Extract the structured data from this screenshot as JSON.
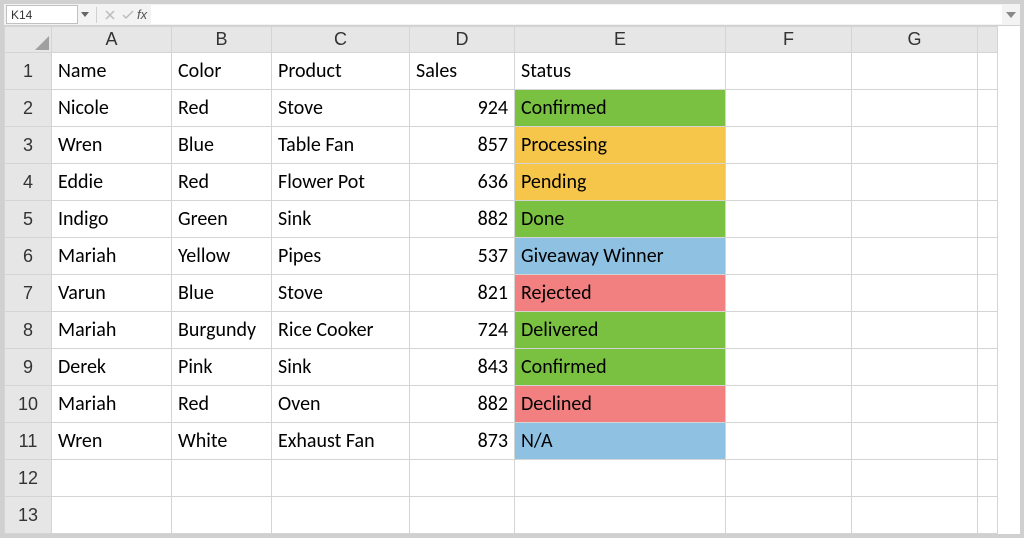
{
  "chart_data": {
    "type": "table",
    "columns": [
      "Name",
      "Color",
      "Product",
      "Sales",
      "Status"
    ],
    "rows": [
      [
        "Nicole",
        "Red",
        "Stove",
        924,
        "Confirmed"
      ],
      [
        "Wren",
        "Blue",
        "Table Fan",
        857,
        "Processing"
      ],
      [
        "Eddie",
        "Red",
        "Flower Pot",
        636,
        "Pending"
      ],
      [
        "Indigo",
        "Green",
        "Sink",
        882,
        "Done"
      ],
      [
        "Mariah",
        "Yellow",
        "Pipes",
        537,
        "Giveaway Winner"
      ],
      [
        "Varun",
        "Blue",
        "Stove",
        821,
        "Rejected"
      ],
      [
        "Mariah",
        "Burgundy",
        "Rice Cooker",
        724,
        "Delivered"
      ],
      [
        "Derek",
        "Pink",
        "Sink",
        843,
        "Confirmed"
      ],
      [
        "Mariah",
        "Red",
        "Oven",
        882,
        "Declined"
      ],
      [
        "Wren",
        "White",
        "Exhaust Fan",
        873,
        "N/A"
      ]
    ]
  },
  "formula_bar": {
    "cell_ref": "K14",
    "fx_label": "fx",
    "formula_value": ""
  },
  "status_colors": {
    "green": "#7ac142",
    "yellow": "#f6c64b",
    "blue": "#8fc1e2",
    "red": "#f28080"
  },
  "columns": [
    "A",
    "B",
    "C",
    "D",
    "E",
    "F",
    "G",
    ""
  ],
  "rows": [
    "1",
    "2",
    "3",
    "4",
    "5",
    "6",
    "7",
    "8",
    "9",
    "10",
    "11",
    "12",
    "13"
  ],
  "headers": {
    "A": "Name",
    "B": "Color",
    "C": "Product",
    "D": "Sales",
    "E": "Status"
  },
  "data": [
    {
      "A": "Nicole",
      "B": "Red",
      "C": "Stove",
      "D": "924",
      "E": "Confirmed",
      "E_class": "status-green"
    },
    {
      "A": "Wren",
      "B": "Blue",
      "C": "Table Fan",
      "D": "857",
      "E": "Processing",
      "E_class": "status-yellow"
    },
    {
      "A": "Eddie",
      "B": "Red",
      "C": "Flower Pot",
      "D": "636",
      "E": "Pending",
      "E_class": "status-yellow"
    },
    {
      "A": "Indigo",
      "B": "Green",
      "C": "Sink",
      "D": "882",
      "E": "Done",
      "E_class": "status-green"
    },
    {
      "A": "Mariah",
      "B": "Yellow",
      "C": "Pipes",
      "D": "537",
      "E": "Giveaway Winner",
      "E_class": "status-blue"
    },
    {
      "A": "Varun",
      "B": "Blue",
      "C": "Stove",
      "D": "821",
      "E": "Rejected",
      "E_class": "status-red"
    },
    {
      "A": "Mariah",
      "B": "Burgundy",
      "C": "Rice Cooker",
      "D": "724",
      "E": "Delivered",
      "E_class": "status-green"
    },
    {
      "A": "Derek",
      "B": "Pink",
      "C": "Sink",
      "D": "843",
      "E": "Confirmed",
      "E_class": "status-green"
    },
    {
      "A": "Mariah",
      "B": "Red",
      "C": "Oven",
      "D": "882",
      "E": "Declined",
      "E_class": "status-red"
    },
    {
      "A": "Wren",
      "B": "White",
      "C": "Exhaust Fan",
      "D": "873",
      "E": "N/A",
      "E_class": "status-blue"
    }
  ]
}
